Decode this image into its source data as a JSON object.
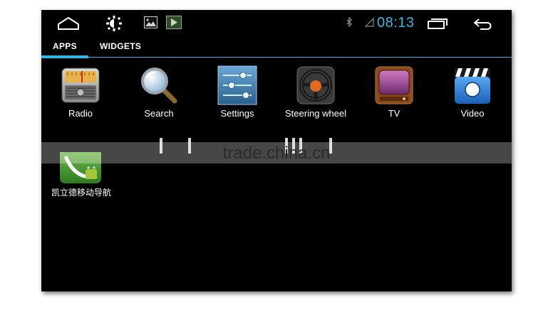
{
  "statusbar": {
    "clock": "08:13",
    "accent": "#33b5e5"
  },
  "tabs": [
    {
      "label": "APPS",
      "selected": true
    },
    {
      "label": "WIDGETS",
      "selected": false
    }
  ],
  "apps": [
    {
      "label": "Radio",
      "icon": "radio-icon"
    },
    {
      "label": "Search",
      "icon": "search-icon"
    },
    {
      "label": "Settings",
      "icon": "settings-sliders-icon"
    },
    {
      "label": "Steering wheel",
      "icon": "steering-wheel-icon"
    },
    {
      "label": "TV",
      "icon": "tv-icon"
    },
    {
      "label": "Video",
      "icon": "clapperboard-icon"
    }
  ],
  "extra_app": {
    "label": "凯立德移动导航",
    "icon": "navigation-app-icon"
  },
  "watermark": {
    "text": "trade.china.cn"
  }
}
